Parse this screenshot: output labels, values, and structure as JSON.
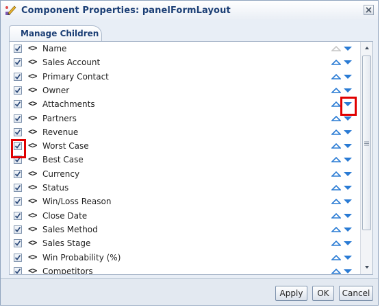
{
  "window": {
    "title": "Component Properties: panelFormLayout",
    "icon": "pencil-icon"
  },
  "tabs": [
    {
      "label": "Manage Children"
    }
  ],
  "children": [
    {
      "name": "Name",
      "checked": true,
      "up_enabled": false
    },
    {
      "name": "Sales Account",
      "checked": true,
      "up_enabled": true
    },
    {
      "name": "Primary Contact",
      "checked": true,
      "up_enabled": true
    },
    {
      "name": "Owner",
      "checked": true,
      "up_enabled": true
    },
    {
      "name": "Attachments",
      "checked": true,
      "up_enabled": true
    },
    {
      "name": "Partners",
      "checked": true,
      "up_enabled": true
    },
    {
      "name": "Revenue",
      "checked": true,
      "up_enabled": true
    },
    {
      "name": "Worst Case",
      "checked": true,
      "up_enabled": true
    },
    {
      "name": "Best Case",
      "checked": true,
      "up_enabled": true
    },
    {
      "name": "Currency",
      "checked": true,
      "up_enabled": true
    },
    {
      "name": "Status",
      "checked": true,
      "up_enabled": true
    },
    {
      "name": "Win/Loss Reason",
      "checked": true,
      "up_enabled": true
    },
    {
      "name": "Close Date",
      "checked": true,
      "up_enabled": true
    },
    {
      "name": "Sales Method",
      "checked": true,
      "up_enabled": true
    },
    {
      "name": "Sales Stage",
      "checked": true,
      "up_enabled": true
    },
    {
      "name": "Win Probability (%)",
      "checked": true,
      "up_enabled": true
    },
    {
      "name": "Competitors",
      "checked": true,
      "up_enabled": true
    }
  ],
  "tag_glyph": "<>",
  "buttons": {
    "apply": "Apply",
    "ok": "OK",
    "cancel": "Cancel"
  },
  "colors": {
    "arrow": "#2a7bd4",
    "arrow_disabled": "#c6c6c6",
    "highlight": "#e00000",
    "title": "#1c3f75"
  }
}
